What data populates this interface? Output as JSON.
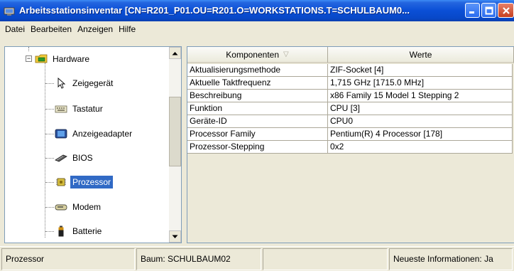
{
  "window": {
    "title": "Arbeitsstationsinventar [CN=R201_P01.OU=R201.O=WORKSTATIONS.T=SCHULBAUM0..."
  },
  "menu": [
    "Datei",
    "Bearbeiten",
    "Anzeigen",
    "Hilfe"
  ],
  "tree": {
    "root": {
      "label": "Hardware",
      "icon": "hardware-folder-icon"
    },
    "items": [
      {
        "label": "Zeigegerät",
        "icon": "mouse-pointer-icon"
      },
      {
        "label": "Tastatur",
        "icon": "keyboard-icon"
      },
      {
        "label": "Anzeigeadapter",
        "icon": "display-adapter-icon"
      },
      {
        "label": "BIOS",
        "icon": "bios-chip-icon"
      },
      {
        "label": "Prozessor",
        "icon": "processor-icon",
        "selected": true
      },
      {
        "label": "Modem",
        "icon": "modem-icon"
      },
      {
        "label": "Batterie",
        "icon": "battery-icon"
      }
    ]
  },
  "table": {
    "columns": [
      "Komponenten",
      "Werte"
    ],
    "rows": [
      [
        "Aktualisierungsmethode",
        "ZIF-Socket [4]"
      ],
      [
        "Aktuelle Taktfrequenz",
        "1,715 GHz [1715.0 MHz]"
      ],
      [
        "Beschreibung",
        "x86 Family 15 Model 1 Stepping 2"
      ],
      [
        "Funktion",
        "CPU [3]"
      ],
      [
        "Geräte-ID",
        "CPU0"
      ],
      [
        "Processor Family",
        "Pentium(R) 4 Processor [178]"
      ],
      [
        "Prozessor-Stepping",
        "0x2"
      ]
    ]
  },
  "status": {
    "panel1": "Prozessor",
    "panel2": "Baum: SCHULBAUM02",
    "panel3": "",
    "panel4": "Neueste Informationen: Ja"
  },
  "colors": {
    "titlebar": "#0a4fd6",
    "selection": "#316ac5",
    "close_button": "#c5401f"
  }
}
